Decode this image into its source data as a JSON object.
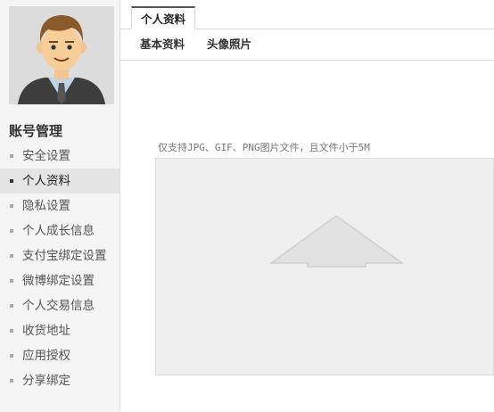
{
  "sidebar": {
    "avatar_alt": "用户头像",
    "section_title": "账号管理",
    "items": [
      {
        "label": "安全设置"
      },
      {
        "label": "个人资料",
        "active": true
      },
      {
        "label": "隐私设置"
      },
      {
        "label": "个人成长信息"
      },
      {
        "label": "支付宝绑定设置"
      },
      {
        "label": "微博绑定设置"
      },
      {
        "label": "个人交易信息"
      },
      {
        "label": "收货地址"
      },
      {
        "label": "应用授权"
      },
      {
        "label": "分享绑定"
      }
    ]
  },
  "main": {
    "tab": "个人资料",
    "subtabs": [
      "基本资料",
      "头像照片"
    ],
    "upload": {
      "hint": "仅支持JPG、GIF、PNG图片文件，且文件小于5M",
      "icon": "upload-arrow-icon"
    }
  },
  "colors": {
    "sidebar_bg": "#f5f5f5",
    "active_item_bg": "#e4e4e4",
    "upload_bg": "#efefef",
    "border": "#d8d8d8"
  }
}
